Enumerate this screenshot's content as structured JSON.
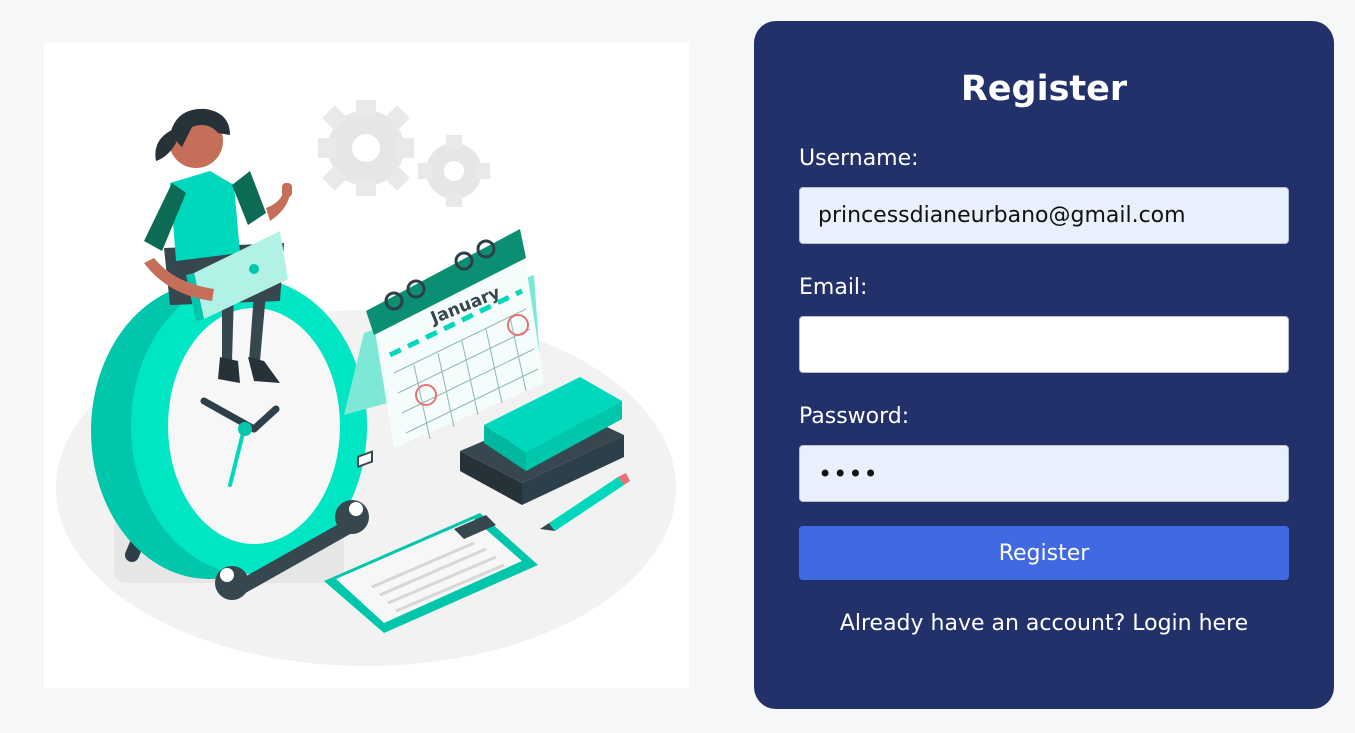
{
  "illustration": {
    "name": "scheduling illustration",
    "calendar_month": "January"
  },
  "form": {
    "title": "Register",
    "username_label": "Username:",
    "username_value": "princessdianeurbano@gmail.com",
    "email_label": "Email:",
    "email_value": "",
    "password_label": "Password:",
    "password_value": "••••",
    "submit_label": "Register",
    "login_prompt": "Already have an account?",
    "login_link": "Login here"
  },
  "colors": {
    "page_background": "#f6f7f9",
    "card_background": "#23316b",
    "button": "#4169e1",
    "autofill_field": "#e8effd",
    "accent_teal": "#00d8bd"
  }
}
